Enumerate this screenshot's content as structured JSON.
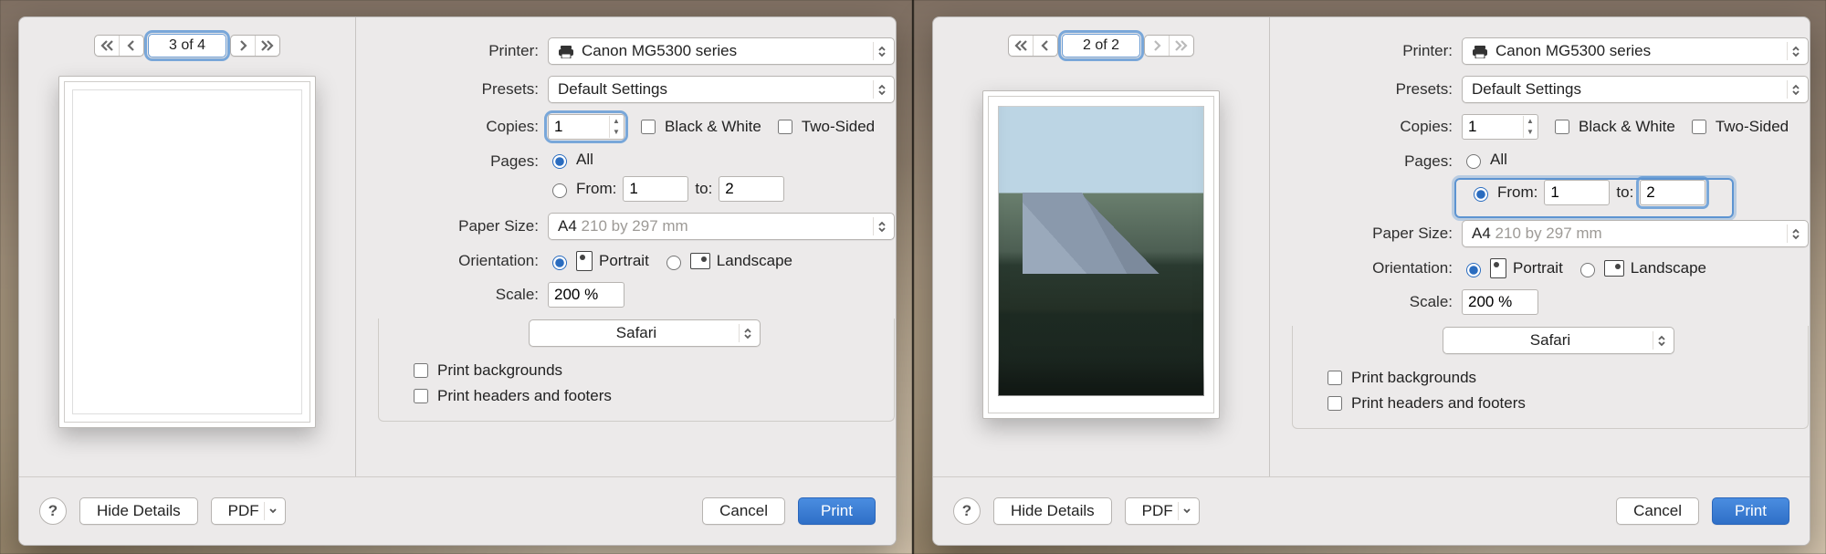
{
  "panes": [
    {
      "page_indicator": "3 of 4",
      "printer_label": "Printer:",
      "printer_value": "Canon MG5300 series",
      "presets_label": "Presets:",
      "presets_value": "Default Settings",
      "copies_label": "Copies:",
      "copies_value": "1",
      "bw_label": "Black & White",
      "twosided_label": "Two-Sided",
      "pages_label": "Pages:",
      "pages_all_label": "All",
      "pages_from_label": "From:",
      "pages_from_value": "1",
      "pages_to_label": "to:",
      "pages_to_value": "2",
      "paper_size_label": "Paper Size:",
      "paper_size_value": "A4",
      "paper_size_ext": "210 by 297 mm",
      "orientation_label": "Orientation:",
      "portrait_label": "Portrait",
      "landscape_label": "Landscape",
      "scale_label": "Scale:",
      "scale_value": "200 %",
      "app_name": "Safari",
      "print_bg_label": "Print backgrounds",
      "print_hf_label": "Print headers and footers",
      "help_glyph": "?",
      "hide_details_label": "Hide Details",
      "pdf_label": "PDF",
      "cancel_label": "Cancel",
      "print_label": "Print",
      "pages_mode": "all",
      "copies_focused": true,
      "preview_kind": "blank"
    },
    {
      "page_indicator": "2 of 2",
      "printer_label": "Printer:",
      "printer_value": "Canon MG5300 series",
      "presets_label": "Presets:",
      "presets_value": "Default Settings",
      "copies_label": "Copies:",
      "copies_value": "1",
      "bw_label": "Black & White",
      "twosided_label": "Two-Sided",
      "pages_label": "Pages:",
      "pages_all_label": "All",
      "pages_from_label": "From:",
      "pages_from_value": "1",
      "pages_to_label": "to:",
      "pages_to_value": "2",
      "paper_size_label": "Paper Size:",
      "paper_size_value": "A4",
      "paper_size_ext": "210 by 297 mm",
      "orientation_label": "Orientation:",
      "portrait_label": "Portrait",
      "landscape_label": "Landscape",
      "scale_label": "Scale:",
      "scale_value": "200 %",
      "app_name": "Safari",
      "print_bg_label": "Print backgrounds",
      "print_hf_label": "Print headers and footers",
      "help_glyph": "?",
      "hide_details_label": "Hide Details",
      "pdf_label": "PDF",
      "cancel_label": "Cancel",
      "print_label": "Print",
      "pages_mode": "from",
      "copies_focused": false,
      "preview_kind": "photo",
      "nav_next_disabled": true
    }
  ]
}
